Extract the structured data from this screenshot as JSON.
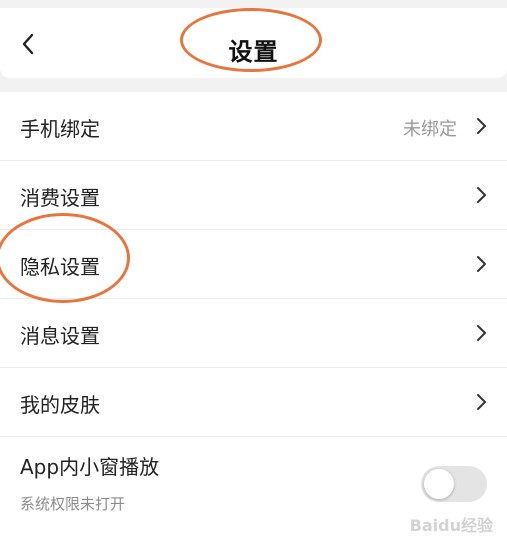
{
  "header": {
    "title": "设置"
  },
  "rows": [
    {
      "label": "手机绑定",
      "value": "未绑定"
    },
    {
      "label": "消费设置"
    },
    {
      "label": "隐私设置"
    },
    {
      "label": "消息设置"
    },
    {
      "label": "我的皮肤"
    },
    {
      "label": "App内小窗播放",
      "sub": "系统权限未打开",
      "toggle_on": false
    }
  ],
  "watermark": "Baidu经验",
  "colors": {
    "annotation": "#e8743e",
    "background": "#f2f2f2"
  }
}
